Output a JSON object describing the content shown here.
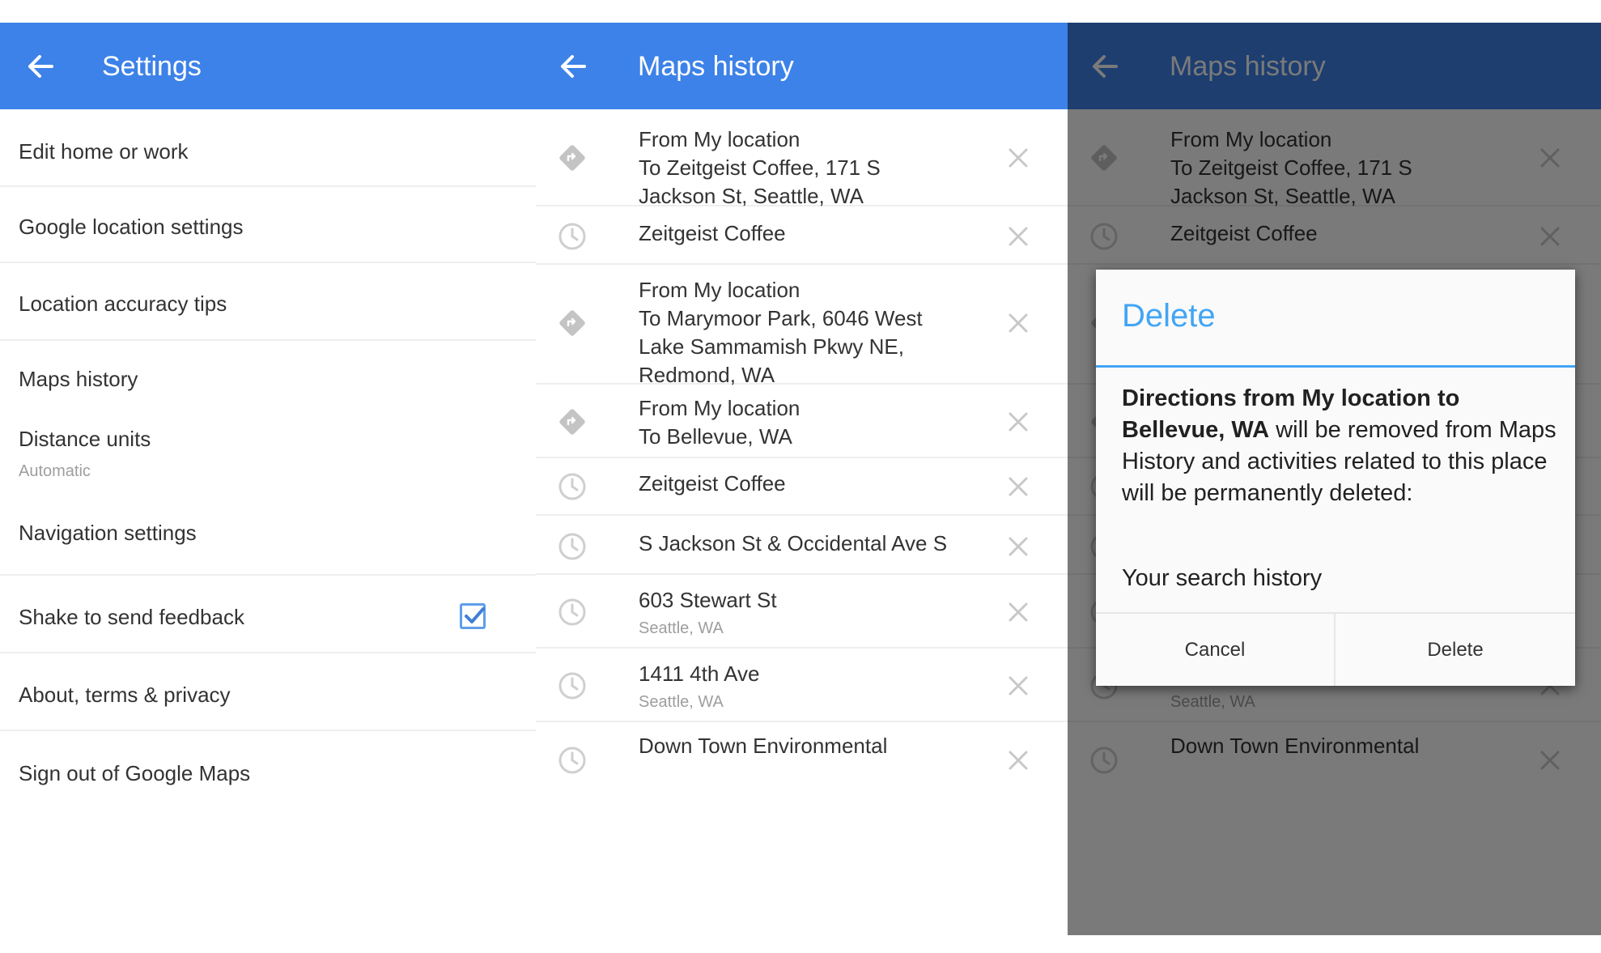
{
  "settings_panel": {
    "title": "Settings",
    "items": [
      {
        "label": "Edit home or work"
      },
      {
        "label": "Google location settings"
      },
      {
        "label": "Location accuracy tips"
      },
      {
        "label": "Maps history"
      },
      {
        "label": "Distance units",
        "sub": "Automatic"
      },
      {
        "label": "Navigation settings"
      },
      {
        "label": "Shake to send feedback",
        "checked": true
      },
      {
        "label": "About, terms & privacy"
      },
      {
        "label": "Sign out of Google Maps"
      }
    ]
  },
  "history_panel": {
    "title": "Maps history",
    "items": [
      {
        "icon": "directions-icon",
        "lines": [
          "From My location",
          "To Zeitgeist Coffee, 171 S",
          "Jackson St, Seattle, WA"
        ]
      },
      {
        "icon": "clock-icon",
        "lines": [
          "Zeitgeist Coffee"
        ]
      },
      {
        "icon": "directions-icon",
        "lines": [
          "From My location",
          "To Marymoor Park, 6046 West",
          "Lake Sammamish Pkwy NE,",
          "Redmond, WA"
        ]
      },
      {
        "icon": "directions-icon",
        "lines": [
          "From My location",
          "To Bellevue, WA"
        ]
      },
      {
        "icon": "clock-icon",
        "lines": [
          "Zeitgeist Coffee"
        ]
      },
      {
        "icon": "clock-icon",
        "lines": [
          "S Jackson St & Occidental Ave S"
        ]
      },
      {
        "icon": "clock-icon",
        "lines": [
          "603 Stewart St"
        ],
        "sub": "Seattle, WA"
      },
      {
        "icon": "clock-icon",
        "lines": [
          "1411 4th Ave"
        ],
        "sub": "Seattle, WA"
      },
      {
        "icon": "clock-icon",
        "lines": [
          "Down Town Environmental"
        ]
      }
    ]
  },
  "dialog": {
    "title": "Delete",
    "body_bold": "Directions from My location to Bellevue, WA",
    "body_rest": " will be removed from Maps History and activities related to this place will be permanently deleted:",
    "item": "Your search history",
    "cancel_label": "Cancel",
    "delete_label": "Delete"
  },
  "colors": {
    "appbar": "#3d82e8",
    "accent": "#42a5f5",
    "checkbox": "#5f9ee8"
  }
}
